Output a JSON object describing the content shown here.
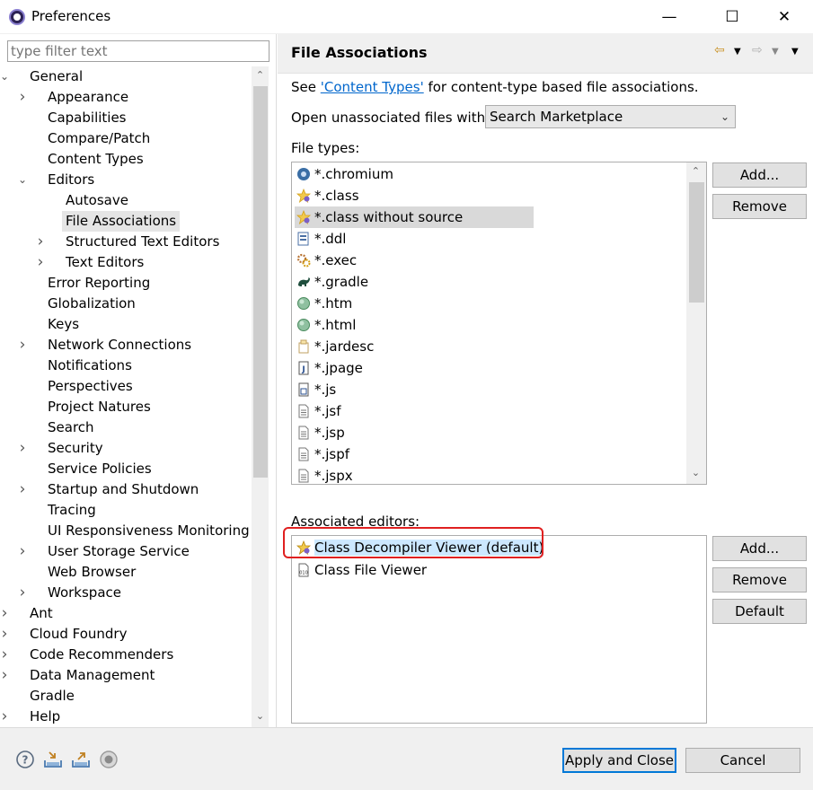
{
  "window": {
    "title": "Preferences",
    "minimize_glyph": "—",
    "maximize_glyph": "☐",
    "close_glyph": "✕"
  },
  "filter": {
    "placeholder": "type filter text"
  },
  "tree": [
    {
      "label": "General",
      "level": 0,
      "expander": "expanded"
    },
    {
      "label": "Appearance",
      "level": 1,
      "expander": "collapsed"
    },
    {
      "label": "Capabilities",
      "level": 1,
      "expander": "none"
    },
    {
      "label": "Compare/Patch",
      "level": 1,
      "expander": "none"
    },
    {
      "label": "Content Types",
      "level": 1,
      "expander": "none"
    },
    {
      "label": "Editors",
      "level": 1,
      "expander": "expanded"
    },
    {
      "label": "Autosave",
      "level": 2,
      "expander": "none"
    },
    {
      "label": "File Associations",
      "level": 2,
      "expander": "none",
      "selected": true
    },
    {
      "label": "Structured Text Editors",
      "level": 2,
      "expander": "collapsed"
    },
    {
      "label": "Text Editors",
      "level": 2,
      "expander": "collapsed"
    },
    {
      "label": "Error Reporting",
      "level": 1,
      "expander": "none"
    },
    {
      "label": "Globalization",
      "level": 1,
      "expander": "none"
    },
    {
      "label": "Keys",
      "level": 1,
      "expander": "none"
    },
    {
      "label": "Network Connections",
      "level": 1,
      "expander": "collapsed"
    },
    {
      "label": "Notifications",
      "level": 1,
      "expander": "none"
    },
    {
      "label": "Perspectives",
      "level": 1,
      "expander": "none"
    },
    {
      "label": "Project Natures",
      "level": 1,
      "expander": "none"
    },
    {
      "label": "Search",
      "level": 1,
      "expander": "none"
    },
    {
      "label": "Security",
      "level": 1,
      "expander": "collapsed"
    },
    {
      "label": "Service Policies",
      "level": 1,
      "expander": "none"
    },
    {
      "label": "Startup and Shutdown",
      "level": 1,
      "expander": "collapsed"
    },
    {
      "label": "Tracing",
      "level": 1,
      "expander": "none"
    },
    {
      "label": "UI Responsiveness Monitoring",
      "level": 1,
      "expander": "none"
    },
    {
      "label": "User Storage Service",
      "level": 1,
      "expander": "collapsed"
    },
    {
      "label": "Web Browser",
      "level": 1,
      "expander": "none"
    },
    {
      "label": "Workspace",
      "level": 1,
      "expander": "collapsed"
    },
    {
      "label": "Ant",
      "level": 0,
      "expander": "collapsed"
    },
    {
      "label": "Cloud Foundry",
      "level": 0,
      "expander": "collapsed"
    },
    {
      "label": "Code Recommenders",
      "level": 0,
      "expander": "collapsed"
    },
    {
      "label": "Data Management",
      "level": 0,
      "expander": "collapsed"
    },
    {
      "label": "Gradle",
      "level": 0,
      "expander": "none"
    },
    {
      "label": "Help",
      "level": 0,
      "expander": "collapsed"
    }
  ],
  "page": {
    "title": "File Associations",
    "see_prefix": "See ",
    "see_link": "'Content Types'",
    "see_suffix": " for content-type based file associations.",
    "open_label": "Open unassociated files with:",
    "open_value": "Search Marketplace",
    "file_types_label": "File types:",
    "associated_label": "Associated editors:"
  },
  "file_types": [
    {
      "label": "*.chromium",
      "icon": "chromium-icon",
      "color": "#3a6ea5"
    },
    {
      "label": "*.class",
      "icon": "class-file-icon",
      "color": "#d4a017"
    },
    {
      "label": "*.class without source",
      "icon": "class-file-icon",
      "color": "#d4a017",
      "selected": true
    },
    {
      "label": "*.ddl",
      "icon": "ddl-file-icon",
      "color": "#4a6fa5"
    },
    {
      "label": "*.exec",
      "icon": "exec-gear-icon",
      "color": "#b87333"
    },
    {
      "label": "*.gradle",
      "icon": "gradle-elephant-icon",
      "color": "#1f4e3d"
    },
    {
      "label": "*.htm",
      "icon": "globe-icon",
      "color": "#4b8b5f"
    },
    {
      "label": "*.html",
      "icon": "globe-icon",
      "color": "#4b8b5f"
    },
    {
      "label": "*.jardesc",
      "icon": "jar-icon",
      "color": "#c0a060"
    },
    {
      "label": "*.jpage",
      "icon": "jpage-icon",
      "color": "#555555"
    },
    {
      "label": "*.js",
      "icon": "js-file-icon",
      "color": "#555555"
    },
    {
      "label": "*.jsf",
      "icon": "text-file-icon",
      "color": "#777777"
    },
    {
      "label": "*.jsp",
      "icon": "text-file-icon",
      "color": "#777777"
    },
    {
      "label": "*.jspf",
      "icon": "text-file-icon",
      "color": "#777777"
    },
    {
      "label": "*.jspx",
      "icon": "text-file-icon",
      "color": "#777777"
    }
  ],
  "associated_editors": [
    {
      "label": "Class Decompiler Viewer (default)",
      "icon": "class-decompiler-icon",
      "selected": true
    },
    {
      "label": "Class File Viewer",
      "icon": "class-viewer-icon"
    }
  ],
  "buttons": {
    "ft_add": "Add...",
    "ft_remove": "Remove",
    "ed_add": "Add...",
    "ed_remove": "Remove",
    "ed_default": "Default",
    "apply_close": "Apply and Close",
    "cancel": "Cancel"
  },
  "bottom_icons": [
    "help-icon",
    "import-icon",
    "export-icon",
    "record-icon"
  ],
  "colors": {
    "selection": "#cce8ff",
    "highlight_border": "#e02020",
    "default_button_border": "#0078d7",
    "link": "#0066cc"
  }
}
